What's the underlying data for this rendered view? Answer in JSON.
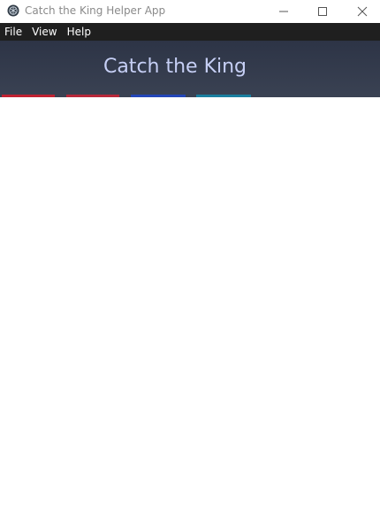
{
  "window": {
    "title": "Catch the King Helper App"
  },
  "menu": {
    "items": [
      {
        "label": "File"
      },
      {
        "label": "View"
      },
      {
        "label": "Help"
      }
    ]
  },
  "header": {
    "title": "Catch the King"
  },
  "colors": {
    "menubar_bg": "#1f1f1f",
    "header_bg": "#353c4d",
    "header_title": "#c6cff5",
    "tab_red": "#c02232",
    "tab_blue": "#2346b8",
    "tab_cyan": "#1a7fa0"
  }
}
